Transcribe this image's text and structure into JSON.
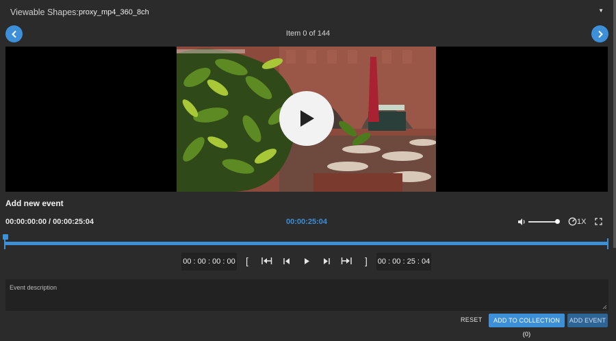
{
  "header": {
    "shapes_label": "Viewable Shapes:",
    "shapes_value": "proxy_mp4_360_8ch"
  },
  "navigation": {
    "item_counter": "Item 0 of 144"
  },
  "player": {
    "title": "Add new event",
    "timecode": "00:00:00:00 / 00:00:25:04",
    "current_time": "00:00:25:04",
    "speed": "1X",
    "volume_fraction": 0.9,
    "timeline_progress": 0.0
  },
  "controls": {
    "in_timecode": "00 : 00 : 00 : 00",
    "out_timecode": "00 : 00 : 25 : 04",
    "mark_in": "[",
    "mark_out": "]"
  },
  "event": {
    "description_placeholder": "Event description"
  },
  "actions": {
    "reset": "RESET",
    "add_to_collection": "ADD TO COLLECTION (0)",
    "add_event": "ADD EVENT"
  },
  "colors": {
    "accent": "#3d8fd8",
    "background": "#2b2b2b",
    "panel": "#222222"
  }
}
